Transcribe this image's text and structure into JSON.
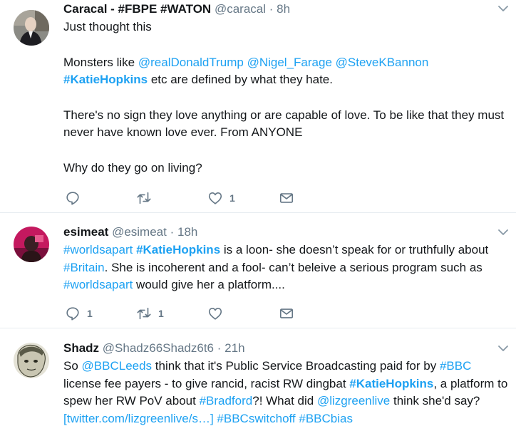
{
  "tweets": [
    {
      "display_name": "Caracal - #FBPE #WATON",
      "handle": "@caracal",
      "dot": "·",
      "time": "8h",
      "paragraphs": [
        [
          "Just thought this"
        ],
        [
          "Monsters like ",
          "@realDonaldTrump",
          " ",
          "@Nigel_Farage",
          " ",
          "@SteveKBannon",
          " ",
          "#KatieHopkins",
          " etc are defined by what they hate."
        ],
        [
          "There's no sign they love anything or are capable of love.  To be like that they must never have known love ever. From ANYONE"
        ],
        [
          "Why do they go on living?"
        ]
      ],
      "counts": {
        "reply": "",
        "retweet": "",
        "like": "1"
      }
    },
    {
      "display_name": "esimeat",
      "handle": "@esimeat",
      "dot": "·",
      "time": "18h",
      "paragraphs": [
        [
          "#worldsapart",
          " ",
          "#KatieHopkins",
          " is a loon- she doesn’t speak for or truthfully about ",
          "#Britain",
          ". She is incoherent and a fool- can’t beleive a serious program such as ",
          "#worldsapart",
          " would give her a platform...."
        ]
      ],
      "counts": {
        "reply": "1",
        "retweet": "1",
        "like": ""
      }
    },
    {
      "display_name": "Shadz",
      "handle": "@Shadz66Shadz6t6",
      "dot": "·",
      "time": "21h",
      "paragraphs": [
        [
          "So ",
          "@BBCLeeds",
          " think that it's Public Service Broadcasting paid for by ",
          "#BBC",
          " license fee payers - to give rancid, racist RW dingbat ",
          "#KatieHopkins",
          ", a platform to spew her RW PoV about ",
          "#Bradford",
          "?! What did ",
          "@lizgreenlive",
          " think she'd say? ",
          "[twitter.com/lizgreenlive/s…]",
          " ",
          "#BBCswitchoff",
          " ",
          "#BBCbias"
        ]
      ]
    }
  ],
  "colors": {
    "link": "#1da1f2",
    "meta": "#657786",
    "text": "#14171a",
    "divider": "#e6ecf0"
  },
  "icons": [
    "reply-icon",
    "retweet-icon",
    "like-icon",
    "message-icon",
    "chevron-down-icon"
  ]
}
